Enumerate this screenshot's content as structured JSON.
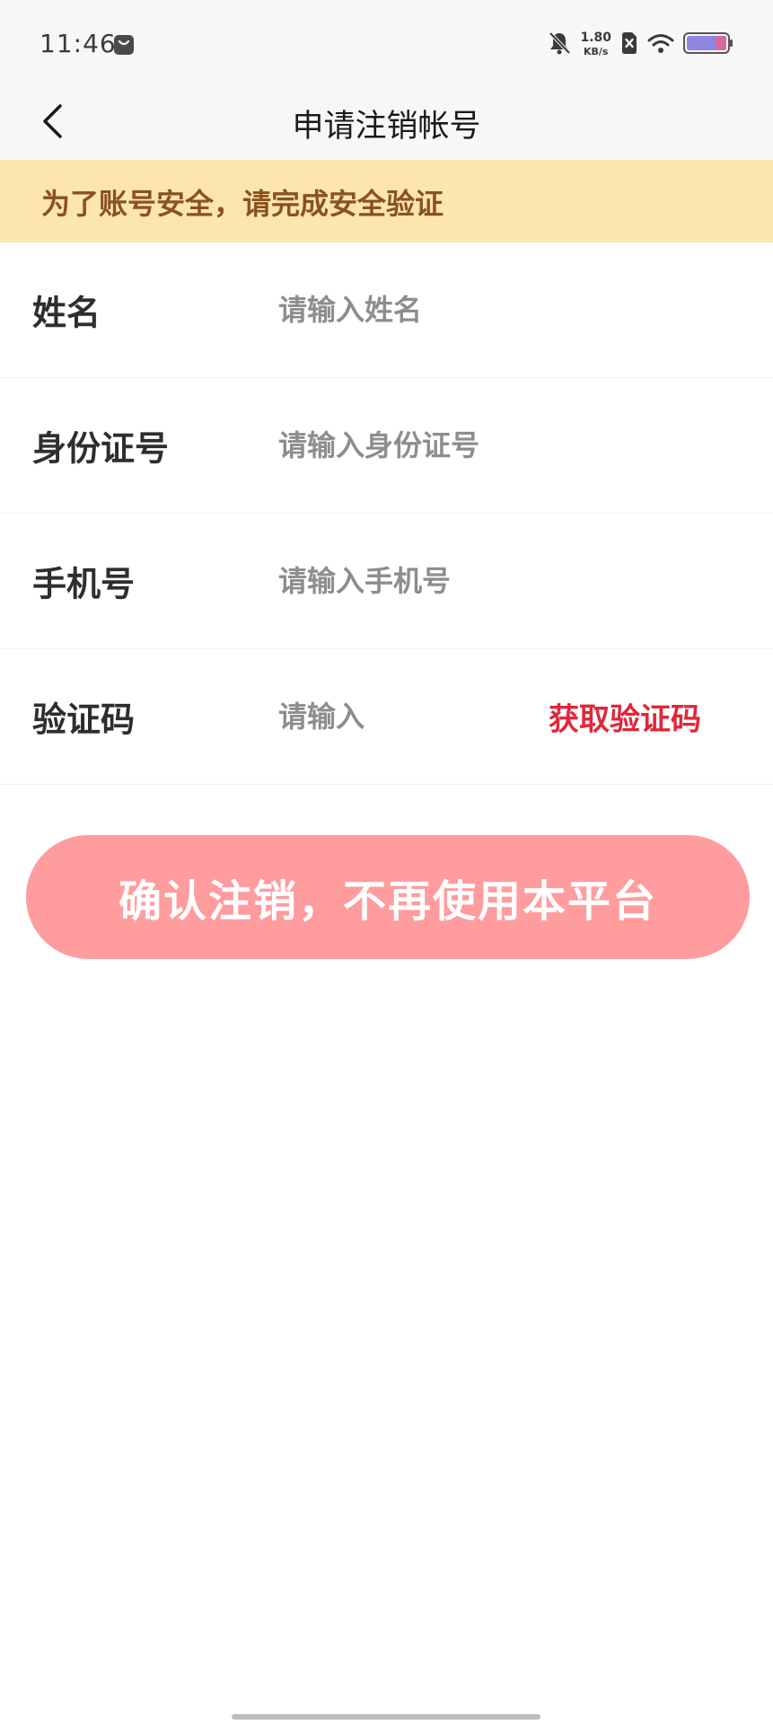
{
  "status_bar": {
    "time": "11:46",
    "net_speed_value": "1.80",
    "net_speed_unit": "KB/s",
    "icons": [
      "app-notification-icon",
      "mute-bell-icon",
      "no-sim-icon",
      "wifi-icon",
      "battery-icon"
    ]
  },
  "nav": {
    "title": "申请注销帐号",
    "back_icon": "chevron-left-icon"
  },
  "banner": {
    "text": "为了账号安全，请完成安全验证"
  },
  "form": {
    "rows": [
      {
        "label": "姓名",
        "placeholder": "请输入姓名",
        "value": ""
      },
      {
        "label": "身份证号",
        "placeholder": "请输入身份证号",
        "value": ""
      },
      {
        "label": "手机号",
        "placeholder": "请输入手机号",
        "value": ""
      },
      {
        "label": "验证码",
        "placeholder": "请输入",
        "value": ""
      }
    ],
    "get_code_label": "获取验证码"
  },
  "confirm_button_label": "确认注销，不再使用本平台",
  "colors": {
    "banner_bg": "#fce6ad",
    "banner_text": "#8a5220",
    "accent_red": "#e2263a",
    "confirm_bg": "#ff9c9e"
  }
}
